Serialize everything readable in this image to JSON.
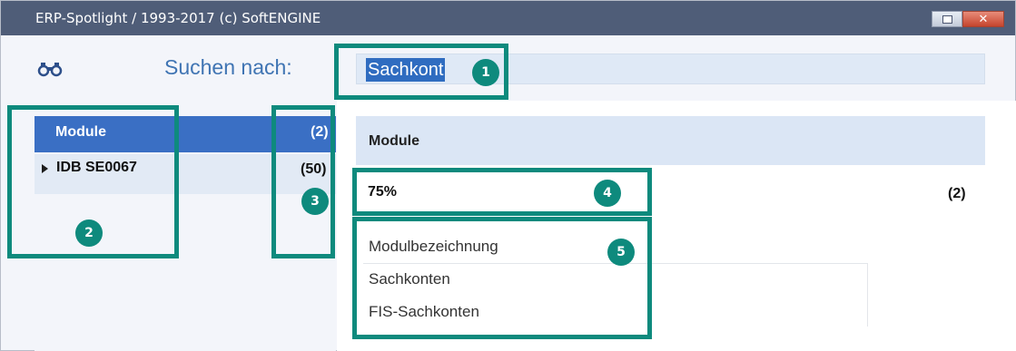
{
  "window": {
    "title": "ERP-Spotlight / 1993-2017 (c) SoftENGINE"
  },
  "search": {
    "label": "Suchen nach:",
    "value": "Sachkont"
  },
  "left_list": {
    "header": {
      "label": "Module",
      "count": "(2)"
    },
    "rows": [
      {
        "label": "IDB SE0067",
        "count": "(50)"
      }
    ]
  },
  "result": {
    "header": "Module",
    "match_label": "75%",
    "match_count": "(2)",
    "fields": [
      "Modulbezeichnung",
      "Sachkonten",
      "FIS-Sachkonten"
    ]
  },
  "callouts": [
    "1",
    "2",
    "3",
    "4",
    "5"
  ],
  "colors": {
    "titlebar": "#4f5d78",
    "accent": "#3a6fc4",
    "callout": "#0e8a7d"
  },
  "icons": [
    "binoculars-icon",
    "restore-icon",
    "close-icon",
    "expand-arrow-icon"
  ]
}
